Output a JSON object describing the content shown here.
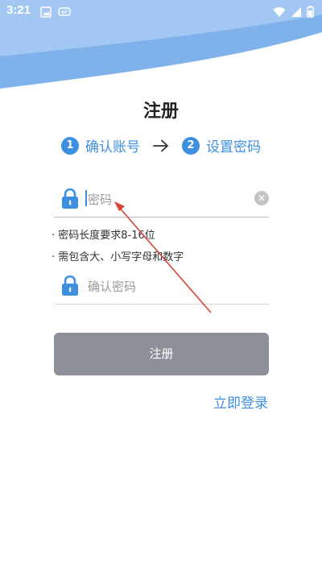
{
  "status_bar": {
    "time": "3:21",
    "icons": [
      "image-icon",
      "messages-icon",
      "wifi-icon",
      "signal-icon",
      "battery-icon"
    ]
  },
  "page": {
    "title": "注册"
  },
  "stepper": {
    "steps": [
      {
        "number": "1",
        "label": "确认账号"
      },
      {
        "number": "2",
        "label": "设置密码"
      }
    ]
  },
  "form": {
    "password": {
      "placeholder": "密码"
    },
    "hints": [
      "· 密码长度要求8-16位",
      "· 需包含大、小写字母和数字"
    ],
    "confirm": {
      "placeholder": "确认密码"
    },
    "submit_label": "注册",
    "login_link": "立即登录"
  },
  "colors": {
    "accent": "#3D8FE0",
    "button_disabled": "#8C9099",
    "header_blue": "#7FB1EA",
    "annotation_arrow": "#D9443A"
  }
}
